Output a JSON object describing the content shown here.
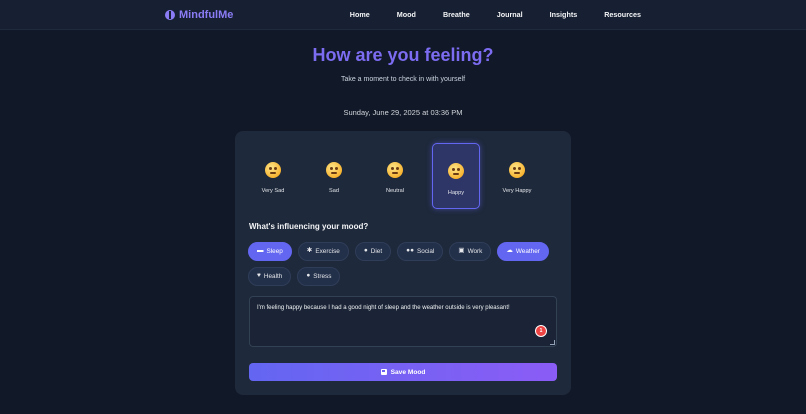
{
  "nav": {
    "brand": "MindfulMe",
    "links": [
      "Home",
      "Mood",
      "Breathe",
      "Journal",
      "Insights",
      "Resources"
    ]
  },
  "hero": {
    "title": "How are you feeling?",
    "subtitle": "Take a moment to check in with yourself"
  },
  "date": "Sunday, June 29, 2025 at 03:36 PM",
  "moods": [
    {
      "label": "Very Sad",
      "icon": "very-sad-face-icon",
      "selected": false
    },
    {
      "label": "Sad",
      "icon": "sad-face-icon",
      "selected": false
    },
    {
      "label": "Neutral",
      "icon": "neutral-face-icon",
      "selected": false
    },
    {
      "label": "Happy",
      "icon": "happy-face-icon",
      "selected": true
    },
    {
      "label": "Very Happy",
      "icon": "very-happy-face-icon",
      "selected": false
    }
  ],
  "influences": {
    "title": "What's influencing your mood?",
    "tags": [
      {
        "label": "Sleep",
        "icon": "bed-icon",
        "active": true
      },
      {
        "label": "Exercise",
        "icon": "running-icon",
        "active": false
      },
      {
        "label": "Diet",
        "icon": "apple-icon",
        "active": false
      },
      {
        "label": "Social",
        "icon": "users-icon",
        "active": false
      },
      {
        "label": "Work",
        "icon": "briefcase-icon",
        "active": false
      },
      {
        "label": "Weather",
        "icon": "cloud-icon",
        "active": true
      },
      {
        "label": "Health",
        "icon": "heart-icon",
        "active": false
      },
      {
        "label": "Stress",
        "icon": "brain-icon",
        "active": false
      }
    ]
  },
  "note": {
    "value": "I'm feeling happy because I had a good night of sleep and the weather outside is very pleasant!",
    "badge": "1"
  },
  "save_label": "Save Mood",
  "colors": {
    "accent": "#6366f1",
    "accent2": "#8b5cf6",
    "background": "#111827",
    "card": "#1e293b"
  }
}
